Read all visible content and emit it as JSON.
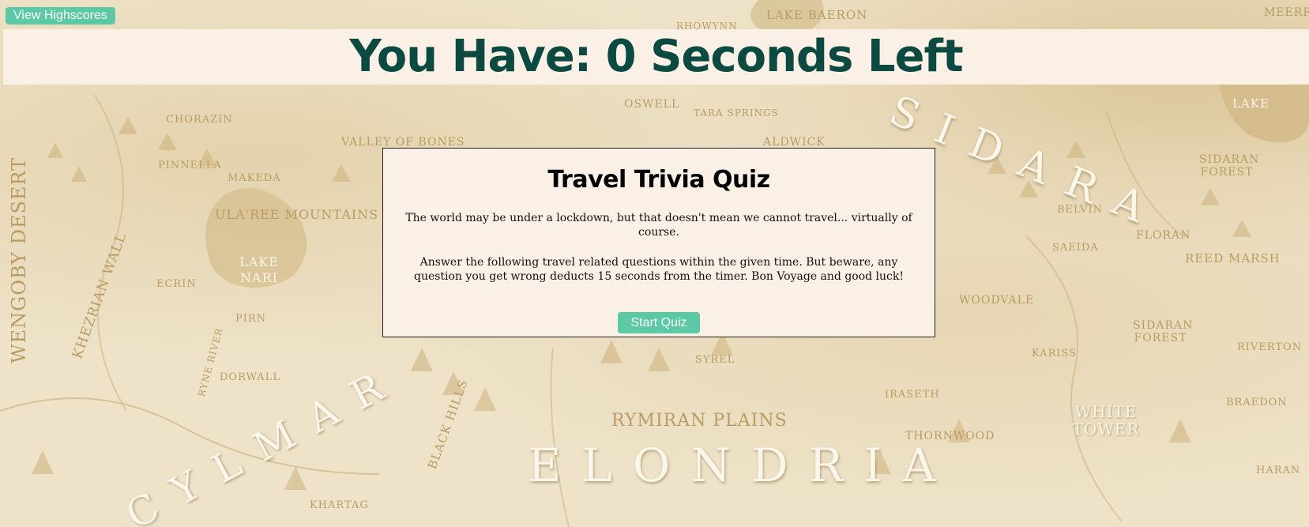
{
  "header": {
    "highscores_label": "View Highscores",
    "timer_text": "You Have: 0 Seconds Left"
  },
  "quiz": {
    "title": "Travel Trivia Quiz",
    "intro": "The world may be under a lockdown, but that doesn't mean we cannot travel... virtually of course.",
    "rules": "Answer the following travel related questions within the given time. But beware, any question you get wrong deducts 15 seconds from the timer. Bon Voyage and good luck!",
    "start_label": "Start Quiz"
  },
  "map_labels": {
    "lake_baeron": "LAKE BAERON",
    "rhowynn": "RHOWYNN",
    "oswell": "OSWELL",
    "tara_springs": "TARA SPRINGS",
    "aldwick": "ALDWICK",
    "chorazin": "CHORAZIN",
    "valley_of_bones": "VALLEY OF BONES",
    "pinnella": "PINNELLA",
    "makeda": "MAKEDA",
    "ula_ree_mountains": "ULA'REE MOUNTAINS",
    "lake_nari": "LAKE NARI",
    "ecrin": "ECRIN",
    "pirn": "PIRN",
    "dorwall": "DORWALL",
    "ryne_river": "RYNE RIVER",
    "wengoby_desert": "WENGOBY DESERT",
    "khezrian_wall": "KHEZRIAN WALL",
    "syrel": "SYREL",
    "black_hills": "BLACK HILLS",
    "rymiran_plains": "RYMIRAN PLAINS",
    "elondria": "ELONDRIA",
    "cylmar": "CYLMAR",
    "sidara": "SIDARA",
    "belvin": "BELVIN",
    "floran": "FLORAN",
    "reed_marsh": "REED MARSH",
    "saeida": "SAEIDA",
    "sidaran_forest_1": "SIDARAN FOREST",
    "sidaran_forest_2": "SIDARAN FOREST",
    "woodvale": "WOODVALE",
    "kariss": "KARISS",
    "riverton": "RIVERTON",
    "iraseth": "IRASETH",
    "thornwood": "THORNWOOD",
    "white_tower": "WHITE TOWER",
    "braedon": "BRAEDON",
    "haran": "HARAN",
    "khartag": "KHARTAG",
    "lake_east": "LAKE",
    "meerr": "MEERR"
  }
}
